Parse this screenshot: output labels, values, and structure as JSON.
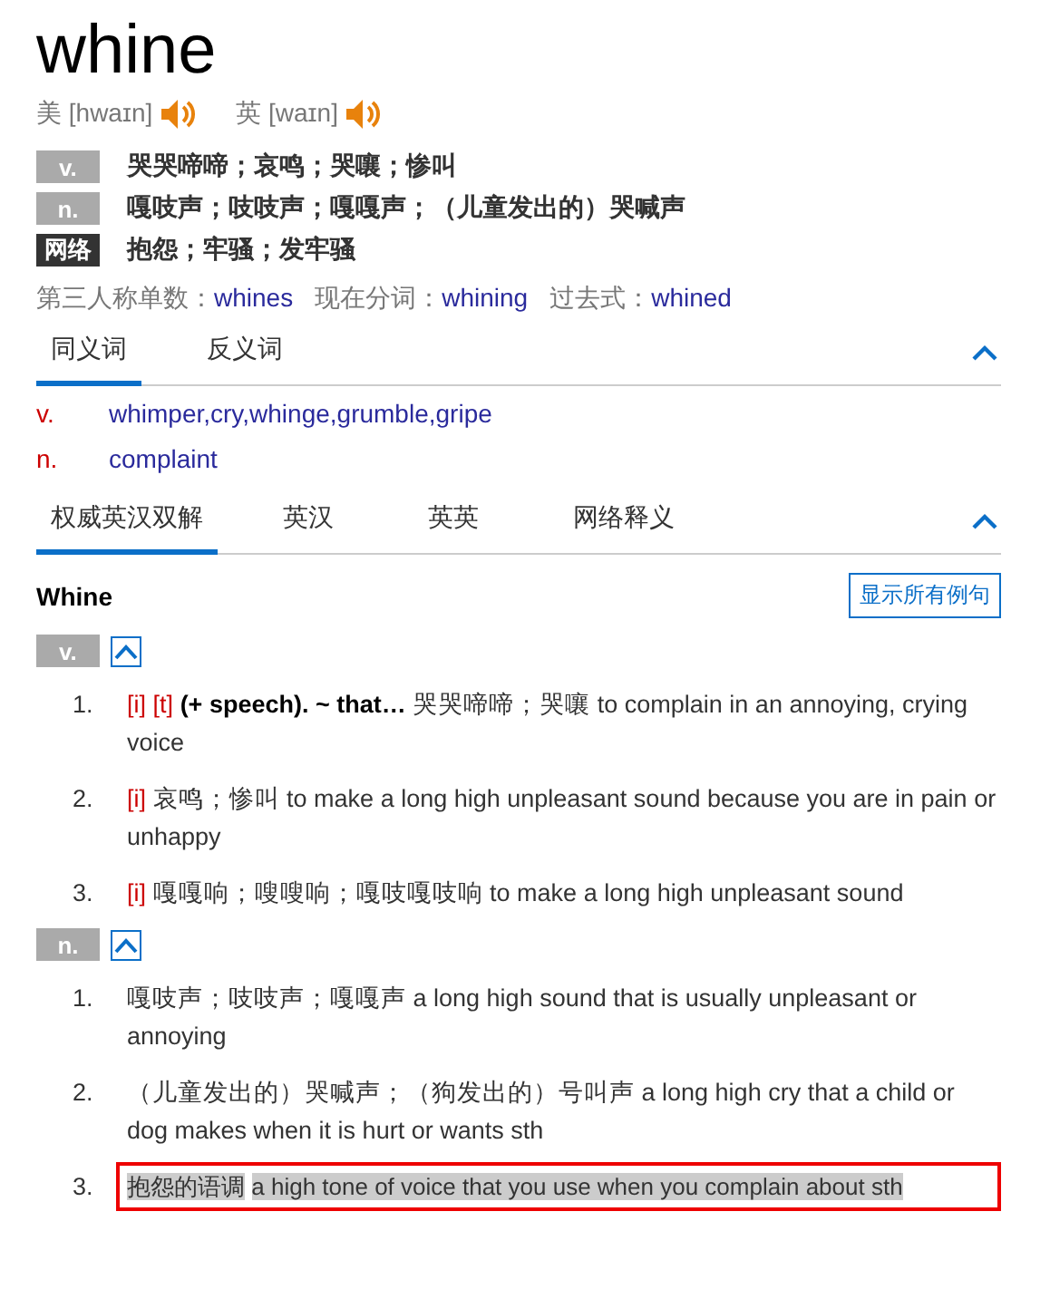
{
  "word": "whine",
  "pronunciations": [
    {
      "label": "美",
      "phonetic": "[hwaɪn]"
    },
    {
      "label": "英",
      "phonetic": "[waɪn]"
    }
  ],
  "basic_definitions": [
    {
      "pos": "v.",
      "kind": "pos",
      "text": "哭哭啼啼；哀鸣；哭嚷；惨叫"
    },
    {
      "pos": "n.",
      "kind": "pos",
      "text": "嘎吱声；吱吱声；嘎嘎声；（儿童发出的）哭喊声"
    },
    {
      "pos": "网络",
      "kind": "web",
      "text": "抱怨；牢骚；发牢骚"
    }
  ],
  "word_forms": [
    {
      "label": "第三人称单数：",
      "value": "whines"
    },
    {
      "label": "现在分词：",
      "value": "whining"
    },
    {
      "label": "过去式：",
      "value": "whined"
    }
  ],
  "synonym_tabs": [
    {
      "label": "同义词",
      "selected": true
    },
    {
      "label": "反义词",
      "selected": false
    }
  ],
  "synonyms": [
    {
      "pos": "v.",
      "words": "whimper,cry,whinge,grumble,gripe"
    },
    {
      "pos": "n.",
      "words": "complaint"
    }
  ],
  "dictionary_tabs": [
    {
      "label": "权威英汉双解",
      "selected": true
    },
    {
      "label": "英汉",
      "selected": false
    },
    {
      "label": "英英",
      "selected": false
    },
    {
      "label": "网络释义",
      "selected": false
    }
  ],
  "entry": {
    "headword": "Whine",
    "show_examples_button": "显示所有例句",
    "groups": [
      {
        "pos": "v.",
        "senses": [
          {
            "num": "1.",
            "tags": [
              "[i]",
              "[t]"
            ],
            "pattern": "(+ speech). ~ that…",
            "zh": "哭哭啼啼；哭嚷",
            "en": "to complain in an annoying, crying voice",
            "highlighted": false
          },
          {
            "num": "2.",
            "tags": [
              "[i]"
            ],
            "zh": "哀鸣；惨叫",
            "en": "to make a long high unpleasant sound because you are in pain or unhappy",
            "highlighted": false
          },
          {
            "num": "3.",
            "tags": [
              "[i]"
            ],
            "zh": "嘎嘎响；嗖嗖响；嘎吱嘎吱响",
            "en": "to make a long high unpleasant sound",
            "highlighted": false
          }
        ]
      },
      {
        "pos": "n.",
        "senses": [
          {
            "num": "1.",
            "zh": "嘎吱声；吱吱声；嘎嘎声",
            "en": "a long high sound that is usually unpleasant or annoying",
            "highlighted": false
          },
          {
            "num": "2.",
            "zh": "（儿童发出的）哭喊声；（狗发出的）号叫声",
            "en": "a long high cry that a child or dog makes when it is hurt or wants sth",
            "highlighted": false
          },
          {
            "num": "3.",
            "zh": "抱怨的语调",
            "en": "a high tone of voice that you use when you complain about sth",
            "highlighted": true
          }
        ]
      }
    ]
  }
}
